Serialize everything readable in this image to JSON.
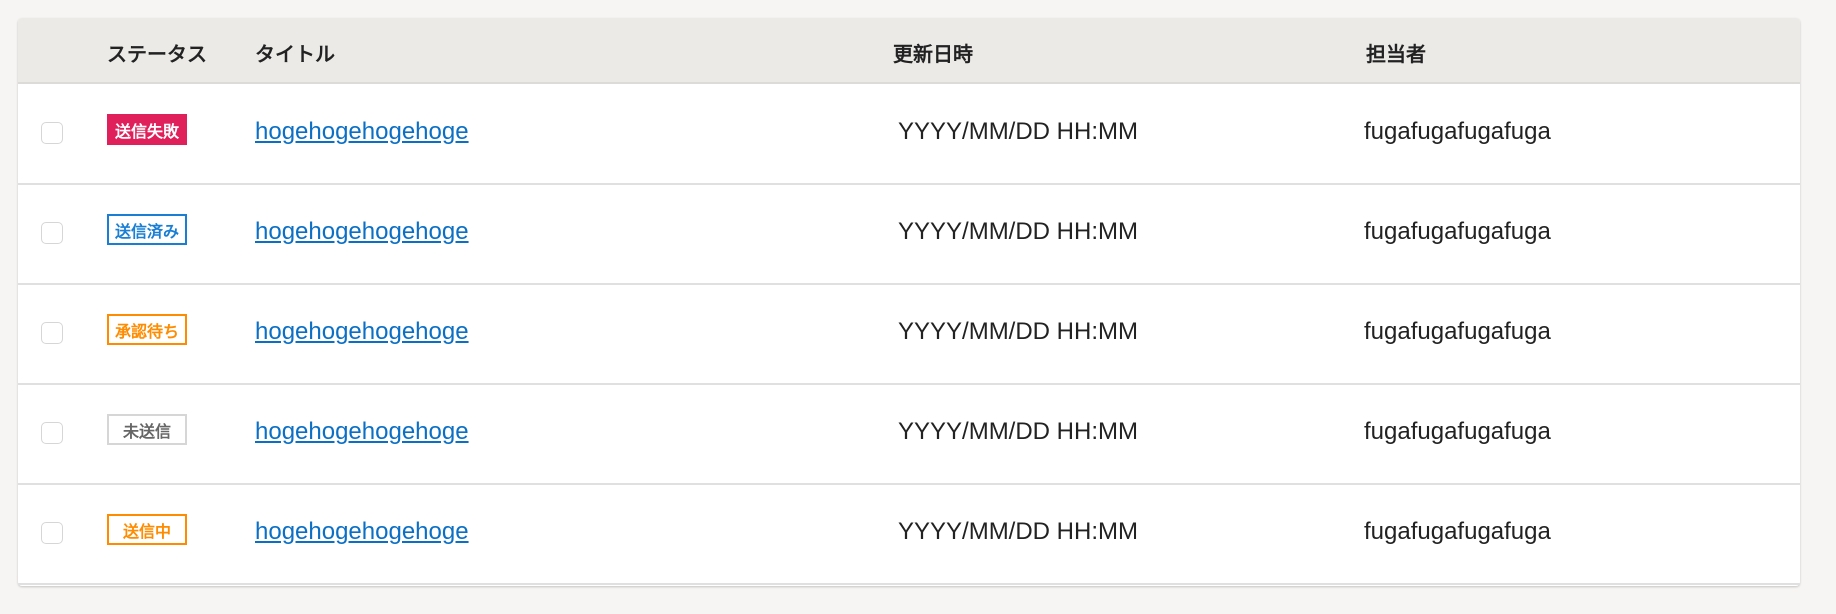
{
  "headers": {
    "status": "ステータス",
    "title": "タイトル",
    "updated": "更新日時",
    "assignee": "担当者"
  },
  "rows": [
    {
      "status": "送信失敗",
      "status_kind": "failed",
      "title": "hogehogehogehoge",
      "updated": "YYYY/MM/DD HH:MM",
      "assignee": "fugafugafugafuga"
    },
    {
      "status": "送信済み",
      "status_kind": "sent",
      "title": "hogehogehogehoge",
      "updated": "YYYY/MM/DD HH:MM",
      "assignee": "fugafugafugafuga"
    },
    {
      "status": "承認待ち",
      "status_kind": "pending",
      "title": "hogehogehogehoge",
      "updated": "YYYY/MM/DD HH:MM",
      "assignee": "fugafugafugafuga"
    },
    {
      "status": "未送信",
      "status_kind": "unsent",
      "title": "hogehogehogehoge",
      "updated": "YYYY/MM/DD HH:MM",
      "assignee": "fugafugafugafuga"
    },
    {
      "status": "送信中",
      "status_kind": "sending",
      "title": "hogehogehogehoge",
      "updated": "YYYY/MM/DD HH:MM",
      "assignee": "fugafugafugafuga"
    }
  ],
  "colors": {
    "failed": "#e0205a",
    "sent": "#1a7fd4",
    "pending": "#ff8c00",
    "unsent": "#666666",
    "unsent_border": "#d6d6d6",
    "sending": "#ff8c00",
    "link": "#0b6fc6"
  }
}
